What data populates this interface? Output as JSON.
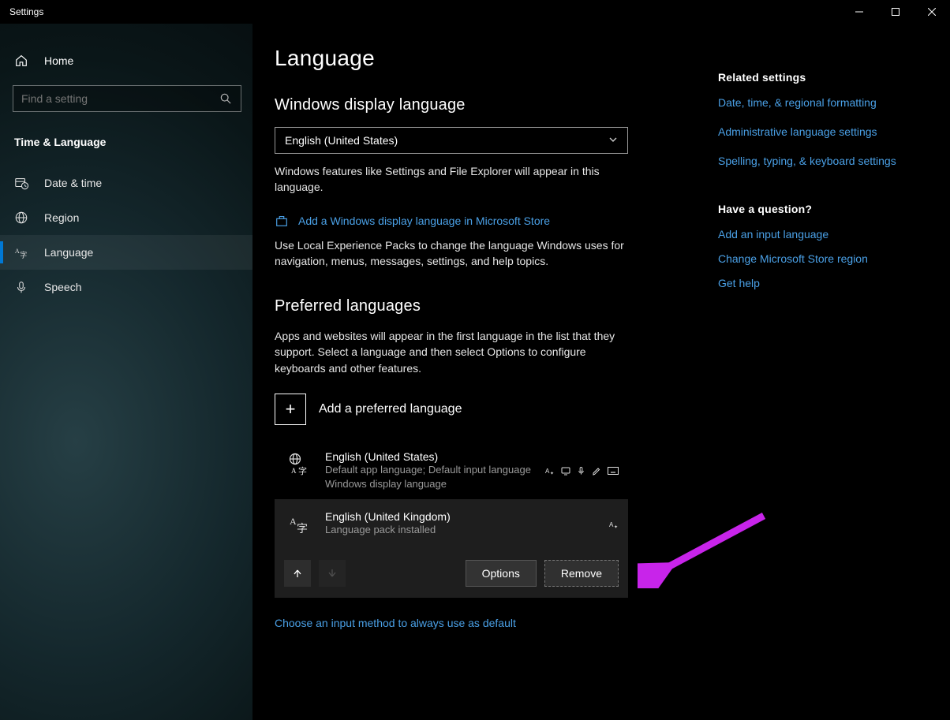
{
  "window": {
    "title": "Settings"
  },
  "sidebar": {
    "home": "Home",
    "search_placeholder": "Find a setting",
    "category": "Time & Language",
    "items": [
      {
        "label": "Date & time"
      },
      {
        "label": "Region"
      },
      {
        "label": "Language"
      },
      {
        "label": "Speech"
      }
    ]
  },
  "main": {
    "title": "Language",
    "display_lang": {
      "heading": "Windows display language",
      "selected": "English (United States)",
      "desc": "Windows features like Settings and File Explorer will appear in this language.",
      "store_link": "Add a Windows display language in Microsoft Store",
      "packs_desc": "Use Local Experience Packs to change the language Windows uses for navigation, menus, messages, settings, and help topics."
    },
    "preferred": {
      "heading": "Preferred languages",
      "desc": "Apps and websites will appear in the first language in the list that they support. Select a language and then select Options to configure keyboards and other features.",
      "add_label": "Add a preferred language",
      "items": [
        {
          "name": "English (United States)",
          "sub": "Default app language; Default input language\nWindows display language"
        },
        {
          "name": "English (United Kingdom)",
          "sub": "Language pack installed"
        }
      ],
      "options_btn": "Options",
      "remove_btn": "Remove"
    },
    "footer_link": "Choose an input method to always use as default"
  },
  "right": {
    "related_heading": "Related settings",
    "links": [
      "Date, time, & regional formatting",
      "Administrative language settings",
      "Spelling, typing, & keyboard settings"
    ],
    "question_heading": "Have a question?",
    "qlinks": [
      "Add an input language",
      "Change Microsoft Store region",
      "Get help"
    ]
  }
}
